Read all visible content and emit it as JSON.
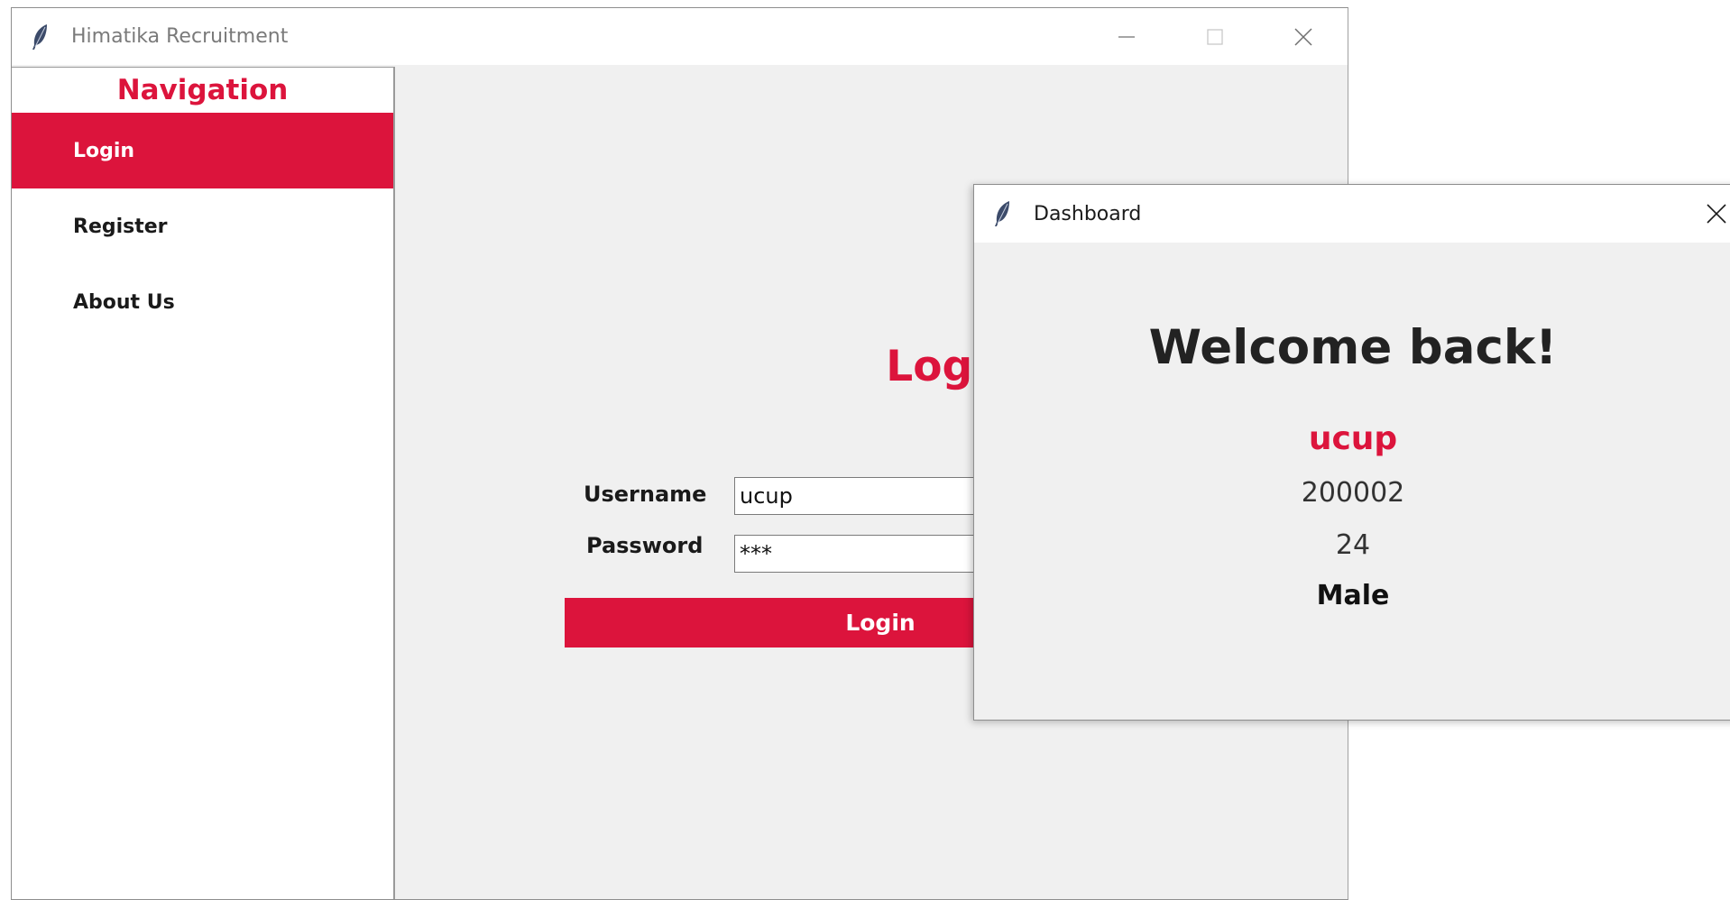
{
  "main_window": {
    "title": "Himatika Recruitment",
    "icon": "feather-icon",
    "controls": [
      "minimize-icon",
      "maximize-icon",
      "close-icon"
    ]
  },
  "sidebar": {
    "heading": "Navigation",
    "items": [
      {
        "label": "Login",
        "active": true
      },
      {
        "label": "Register",
        "active": false
      },
      {
        "label": "About Us",
        "active": false
      }
    ]
  },
  "login_form": {
    "title": "Login",
    "username_label": "Username",
    "username_value": "ucup",
    "password_label": "Password",
    "password_value": "***",
    "submit_label": "Login"
  },
  "dashboard": {
    "title": "Dashboard",
    "icon": "feather-icon",
    "welcome": "Welcome back!",
    "username": "ucup",
    "user_id": "200002",
    "age": "24",
    "gender": "Male"
  },
  "colors": {
    "accent": "#dc143c",
    "window_bg": "#f0f0f0",
    "sidebar_bg": "#ffffff"
  }
}
